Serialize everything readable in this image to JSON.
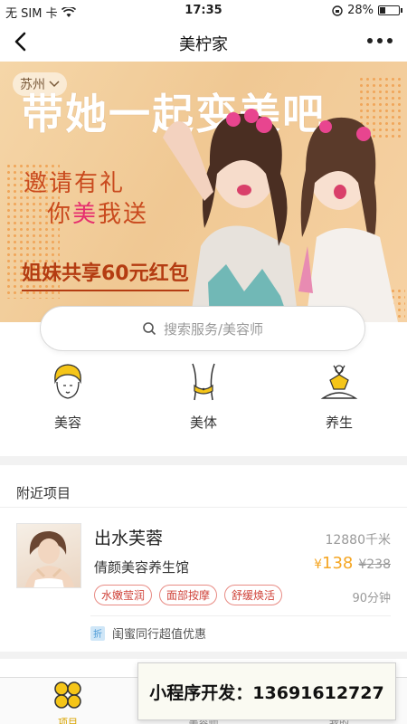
{
  "status_bar": {
    "carrier": "无 SIM 卡",
    "time": "17:35",
    "battery": "28%",
    "battery_level": 0.28
  },
  "nav": {
    "title": "美柠家"
  },
  "banner": {
    "city": "苏州",
    "slogan": "带她一起变美吧",
    "invite_line1": "邀请有礼",
    "invite_line2_a": "你",
    "invite_line2_b": "美",
    "invite_line2_c": "我送",
    "promo": "姐妹共享60元红包"
  },
  "search": {
    "placeholder": "搜索服务/美容师"
  },
  "categories": [
    {
      "label": "美容",
      "icon": "face-care-icon"
    },
    {
      "label": "美体",
      "icon": "body-waist-icon"
    },
    {
      "label": "养生",
      "icon": "yoga-meditation-icon"
    }
  ],
  "nearby": {
    "section_title": "附近项目",
    "items": [
      {
        "name": "出水芙蓉",
        "distance": "12880千米",
        "shop": "倩颜美容养生馆",
        "currency": "¥",
        "price": "138",
        "old_price": "¥238",
        "tags": [
          "水嫩莹润",
          "面部按摩",
          "舒缓焕活"
        ],
        "duration": "90分钟",
        "deal_badge": "折",
        "deal": "闺蜜同行超值优惠"
      }
    ]
  },
  "tab_bar": {
    "tabs": [
      {
        "label": "项目",
        "icon": "clover-icon"
      },
      {
        "label": "美容师",
        "icon": "beautician-icon"
      },
      {
        "label": "我的",
        "icon": "profile-icon"
      }
    ]
  },
  "ad_overlay": {
    "text": "小程序开发：13691612727"
  },
  "colors": {
    "accent": "#f5a623",
    "tag_red": "#d0453c",
    "banner_orange": "#c94a1e"
  }
}
